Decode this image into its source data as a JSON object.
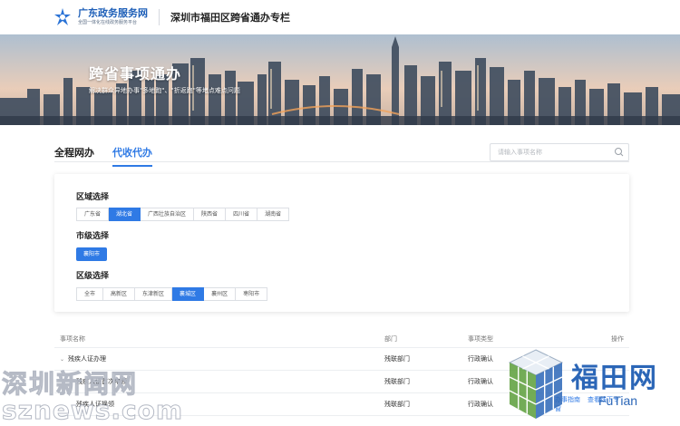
{
  "header": {
    "logo_title": "广东政务服务网",
    "logo_subtitle": "全国一体化在线政务服务平台",
    "site_title": "深圳市福田区跨省通办专栏"
  },
  "banner": {
    "title": "跨省事项通办",
    "subtitle": "解决群众异地办事\"多地跑\"、\"折返跑\"等堵点难点问题"
  },
  "tabs": [
    {
      "label": "全程网办",
      "active": false
    },
    {
      "label": "代收代办",
      "active": true
    }
  ],
  "search": {
    "placeholder": "请输入事项名称",
    "value": ""
  },
  "filters": {
    "region_label": "区域选择",
    "regions": [
      {
        "label": "广东省",
        "active": false
      },
      {
        "label": "湖北省",
        "active": true
      },
      {
        "label": "广西壮族自治区",
        "active": false
      },
      {
        "label": "陕西省",
        "active": false
      },
      {
        "label": "四川省",
        "active": false
      },
      {
        "label": "湖南省",
        "active": false
      }
    ],
    "city_label": "市级选择",
    "cities": [
      {
        "label": "襄阳市",
        "active": true
      }
    ],
    "district_label": "区级选择",
    "districts": [
      {
        "label": "全市",
        "active": false
      },
      {
        "label": "高新区",
        "active": false
      },
      {
        "label": "东津新区",
        "active": false
      },
      {
        "label": "襄城区",
        "active": true
      },
      {
        "label": "襄州区",
        "active": false
      },
      {
        "label": "枣阳市",
        "active": false
      }
    ]
  },
  "table": {
    "headers": [
      "事项名称",
      "部门",
      "事项类型",
      "操作"
    ],
    "rows": [
      {
        "name": "残疾人证办理",
        "dept": "残联部门",
        "type": "行政确认",
        "group": true
      },
      {
        "name": "残疾人证首次申领",
        "dept": "残联部门",
        "type": "行政确认",
        "group": false
      },
      {
        "name": "残疾人证换领",
        "dept": "残联部门",
        "type": "行政确认",
        "group": false,
        "ops": [
          "办事指南",
          "查看线下专窗"
        ]
      }
    ]
  },
  "watermarks": {
    "left_cn": "深圳新闻网",
    "left_en": "sznews.com",
    "right_cn": "福田网",
    "right_en": "FuTian"
  },
  "colors": {
    "accent": "#2f7ae5",
    "brand": "#1e5fb8"
  }
}
